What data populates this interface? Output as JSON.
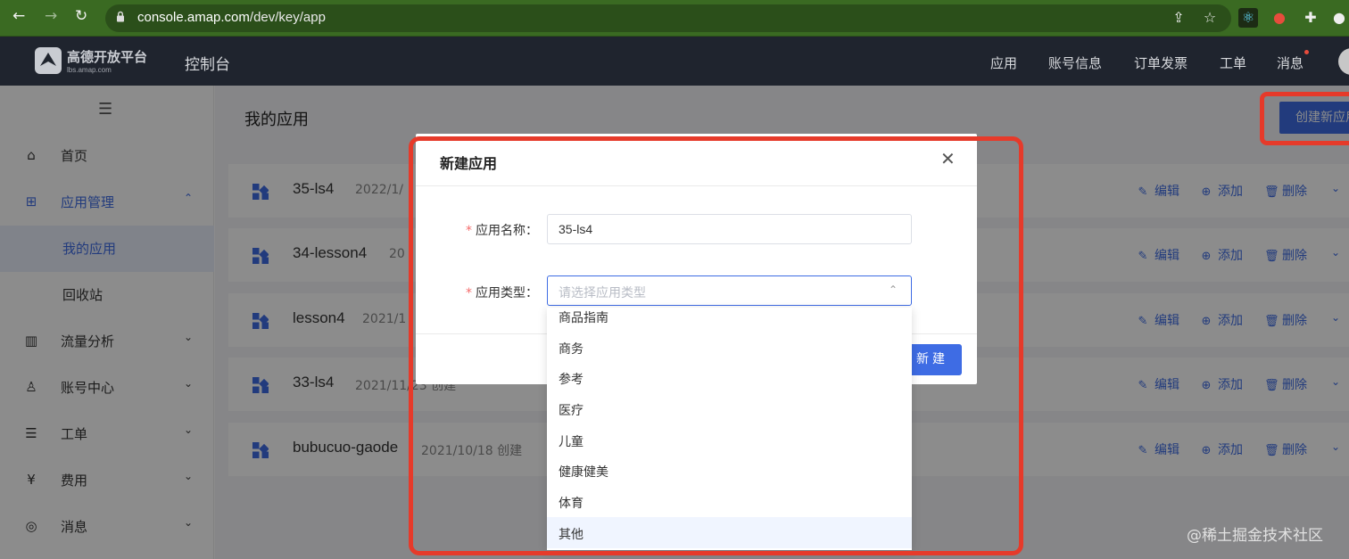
{
  "browser": {
    "url_host": "console.amap.com",
    "url_path": "/dev/key/app"
  },
  "topnav": {
    "logo_name": "高德开放平台",
    "logo_sub": "lbs.amap.com",
    "console_title": "控制台",
    "menu": [
      "应用",
      "账号信息",
      "订单发票",
      "工单",
      "消息"
    ]
  },
  "sidebar": {
    "items": [
      {
        "label": "首页",
        "icon": "home-icon"
      },
      {
        "label": "应用管理",
        "icon": "grid-icon"
      },
      {
        "label": "我的应用"
      },
      {
        "label": "回收站"
      },
      {
        "label": "流量分析",
        "icon": "chart-icon"
      },
      {
        "label": "账号中心",
        "icon": "user-icon"
      },
      {
        "label": "工单",
        "icon": "ticket-icon"
      },
      {
        "label": "费用",
        "icon": "yen-icon"
      },
      {
        "label": "消息",
        "icon": "message-icon"
      }
    ]
  },
  "main": {
    "title": "我的应用",
    "create_button": "创建新应用",
    "apps": [
      {
        "name": "35-ls4",
        "date": "2022/1/"
      },
      {
        "name": "34-lesson4",
        "date": "20"
      },
      {
        "name": "lesson4",
        "date": "2021/1"
      },
      {
        "name": "33-ls4",
        "date": "2021/11/23 创建"
      },
      {
        "name": "bubucuo-gaode",
        "date": "2021/10/18 创建"
      }
    ],
    "actions": {
      "edit": "编辑",
      "add": "添加",
      "delete": "删除"
    }
  },
  "modal": {
    "title": "新建应用",
    "name_label": "应用名称：",
    "name_value": "35-ls4",
    "type_label": "应用类型：",
    "type_placeholder": "请选择应用类型",
    "submit": "新建",
    "options": [
      "商品指南",
      "商务",
      "参考",
      "医疗",
      "儿童",
      "健康健美",
      "体育",
      "其他"
    ],
    "highlighted_option": "其他"
  },
  "watermark": "@稀土掘金技术社区",
  "colors": {
    "accent": "#3e6ce4",
    "highlight": "#e63a2a",
    "nav_bg": "#1f242e"
  }
}
